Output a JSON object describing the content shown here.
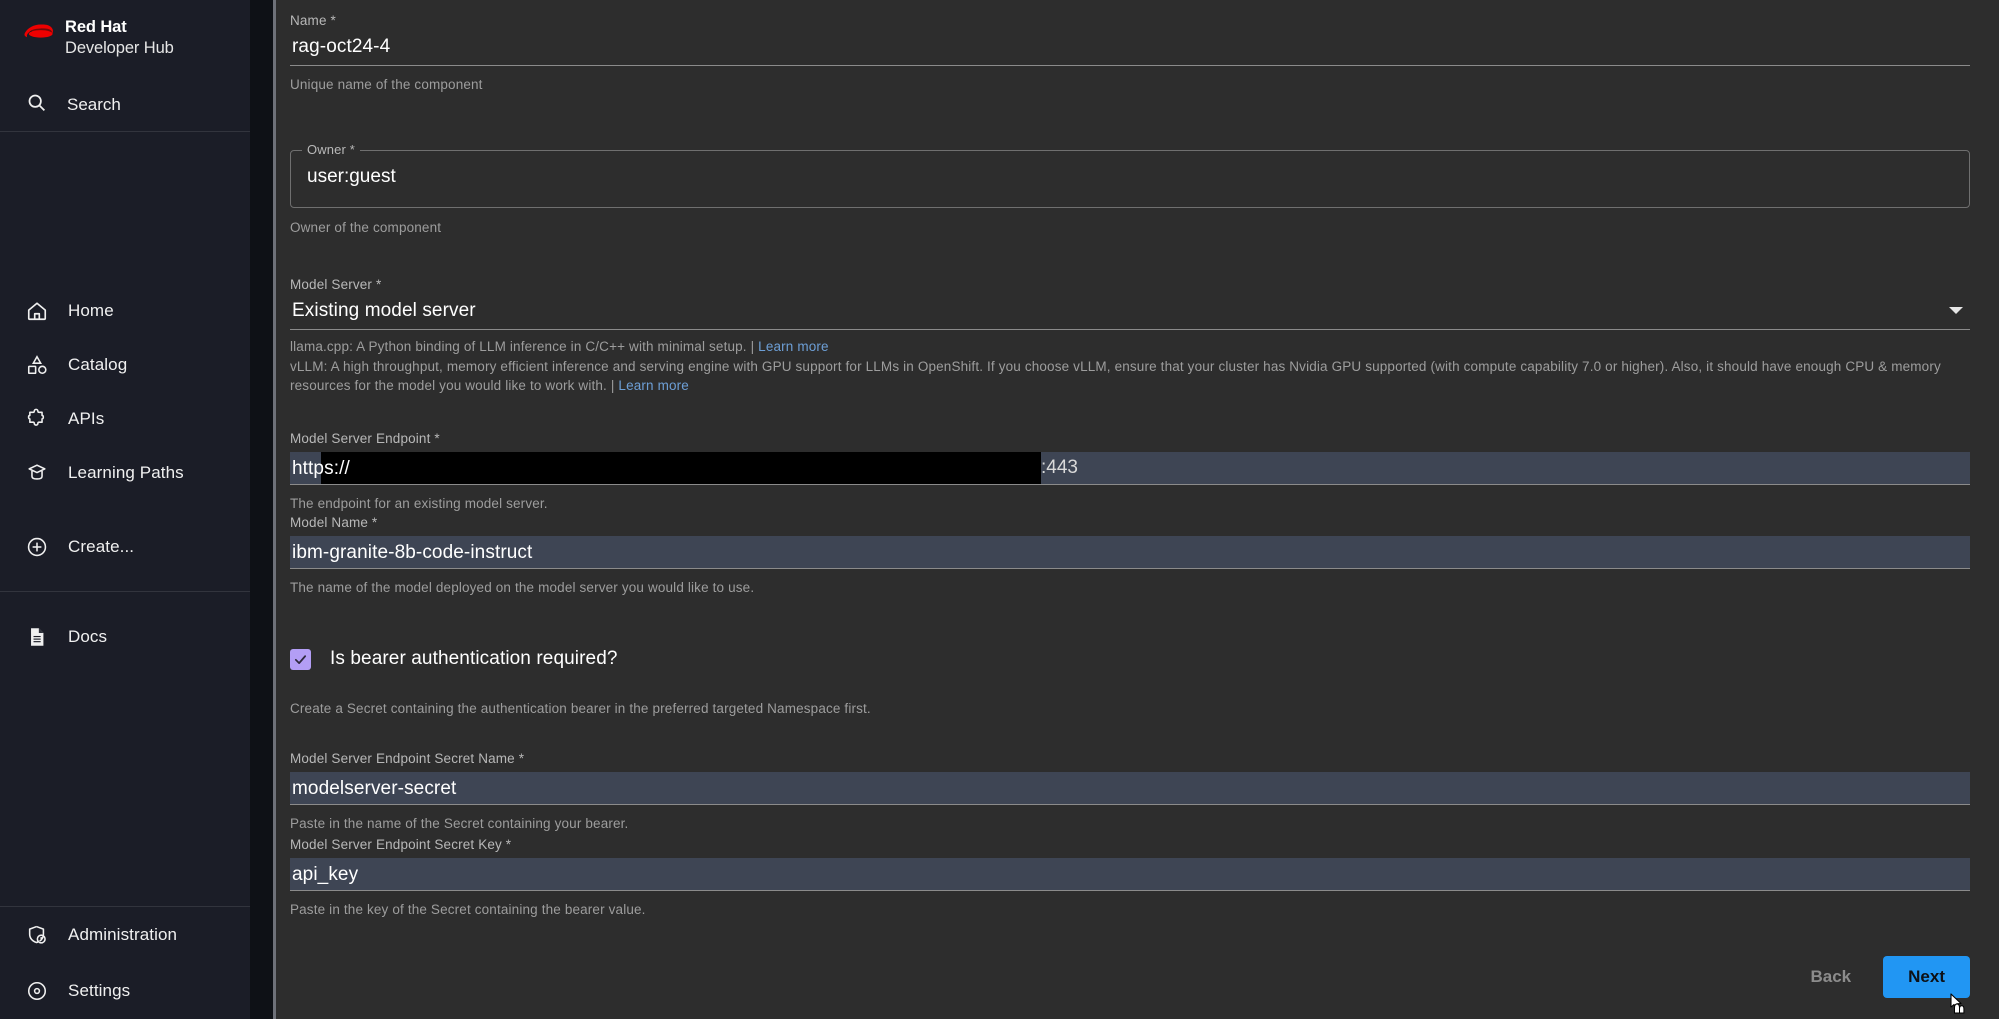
{
  "sidebar": {
    "brand": {
      "line1": "Red Hat",
      "line2": "Developer Hub",
      "logo_color": "#ee0000"
    },
    "search": {
      "label": "Search",
      "icon": "search-icon"
    },
    "items": [
      {
        "label": "Home",
        "icon": "home-icon"
      },
      {
        "label": "Catalog",
        "icon": "catalog-icon"
      },
      {
        "label": "APIs",
        "icon": "apis-puzzle-icon"
      },
      {
        "label": "Learning Paths",
        "icon": "graduation-cap-icon"
      },
      {
        "label": "Create...",
        "icon": "plus-circle-icon"
      }
    ],
    "docs": {
      "label": "Docs",
      "icon": "document-icon"
    },
    "bottom_items": [
      {
        "label": "Administration",
        "icon": "shield-admin-icon"
      },
      {
        "label": "Settings",
        "icon": "gear-settings-icon"
      }
    ]
  },
  "form": {
    "name": {
      "label": "Name *",
      "value": "rag-oct24-4",
      "help": "Unique name of the component"
    },
    "owner": {
      "label": "Owner *",
      "value": "user:guest",
      "help": "Owner of the component"
    },
    "model_server": {
      "label": "Model Server *",
      "value": "Existing model server",
      "options": [
        "Existing model server"
      ],
      "help_llama_prefix": "llama.cpp: A Python binding of LLM inference in C/C++ with minimal setup. | ",
      "help_llama_link": "Learn more",
      "help_vllm_prefix": "vLLM: A high throughput, memory efficient inference and serving engine with GPU support for LLMs in OpenShift. If you choose vLLM, ensure that your cluster has Nvidia GPU supported (with compute capability 7.0 or higher). Also, it should have enough CPU & memory resources for the model you would like to work with. | ",
      "help_vllm_link": "Learn more"
    },
    "endpoint": {
      "label": "Model Server Endpoint *",
      "value_prefix": "https://",
      "value_redacted": true,
      "value_suffix": ":443",
      "help": "The endpoint for an existing model server."
    },
    "model_name": {
      "label": "Model Name *",
      "value": "ibm-granite-8b-code-instruct",
      "help": "The name of the model deployed on the model server you would like to use."
    },
    "bearer_auth": {
      "label": "Is bearer authentication required?",
      "checked": true,
      "help": "Create a Secret containing the authentication bearer in the preferred targeted Namespace first."
    },
    "secret_name": {
      "label": "Model Server Endpoint Secret Name *",
      "value": "modelserver-secret",
      "help": "Paste in the name of the Secret containing your bearer."
    },
    "secret_key": {
      "label": "Model Server Endpoint Secret Key *",
      "value": "api_key",
      "help": "Paste in the key of the Secret containing the bearer value."
    }
  },
  "footer": {
    "back_label": "Back",
    "next_label": "Next",
    "next_color": "#2196f3"
  }
}
